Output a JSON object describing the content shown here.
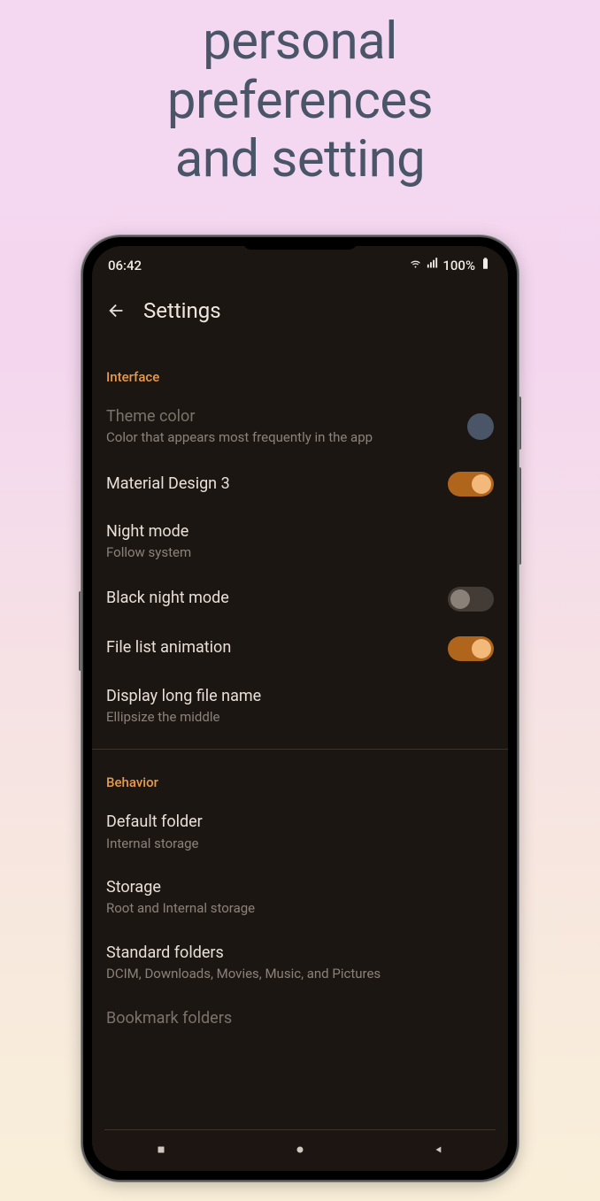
{
  "page_title_lines": [
    "personal",
    "preferences",
    "and setting"
  ],
  "status": {
    "time": "06:42",
    "battery": "100%"
  },
  "header": {
    "title": "Settings"
  },
  "interface": {
    "section_label": "Interface",
    "theme_color": {
      "title": "Theme color",
      "sub": "Color that appears most frequently in the app",
      "swatch": "#4a5568"
    },
    "md3": {
      "title": "Material Design 3",
      "on": true
    },
    "night_mode": {
      "title": "Night mode",
      "sub": "Follow system"
    },
    "black_night": {
      "title": "Black night mode",
      "on": false
    },
    "file_anim": {
      "title": "File list animation",
      "on": true
    },
    "long_name": {
      "title": "Display long file name",
      "sub": "Ellipsize the middle"
    }
  },
  "behavior": {
    "section_label": "Behavior",
    "default_folder": {
      "title": "Default folder",
      "sub": "Internal storage"
    },
    "storage": {
      "title": "Storage",
      "sub": "Root and Internal storage"
    },
    "standard_folders": {
      "title": "Standard folders",
      "sub": "DCIM, Downloads, Movies, Music, and Pictures"
    },
    "bookmark_folders": {
      "title": "Bookmark folders"
    }
  }
}
